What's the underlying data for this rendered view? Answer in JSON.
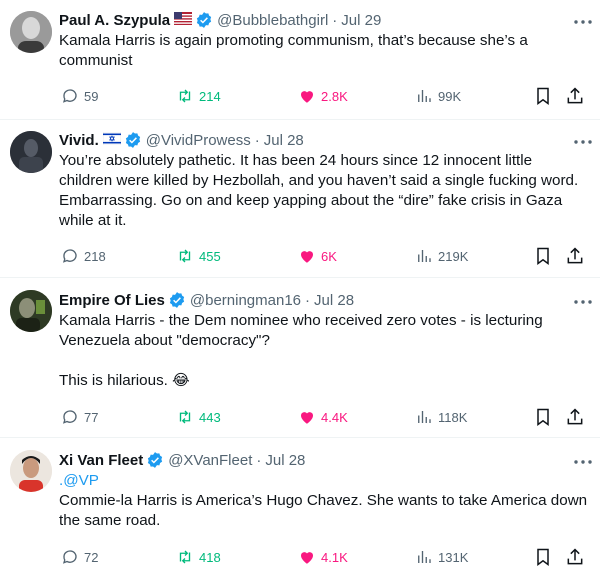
{
  "tweets": [
    {
      "name": "Paul A. Szypula",
      "flag": "us-flag",
      "handle": "@Bubblebathgirl",
      "sep": "·",
      "date": "Jul 29",
      "lines": [
        "Kamala Harris is again promoting communism, that’s because she’s a communist"
      ],
      "replies": "59",
      "retweets": "214",
      "likes": "2.8K",
      "views": "99K"
    },
    {
      "name": "Vivid.",
      "flag": "israel-flag",
      "handle": "@VividProwess",
      "sep": "·",
      "date": "Jul 28",
      "lines": [
        "You’re absolutely pathetic. It has been 24 hours since 12 innocent little children were killed by Hezbollah, and you haven’t said a single fucking word. Embarrassing. Go on and keep yapping about the “dire” fake crisis in Gaza while at it."
      ],
      "replies": "218",
      "retweets": "455",
      "likes": "6K",
      "views": "219K"
    },
    {
      "name": "Empire Of Lies",
      "handle": "@berningman16",
      "sep": "·",
      "date": "Jul 28",
      "lines": [
        "Kamala Harris - the Dem nominee who received zero votes - is lecturing Venezuela about \"democracy\"?",
        "This is hilarious. 😂"
      ],
      "replies": "77",
      "retweets": "443",
      "likes": "4.4K",
      "views": "118K"
    },
    {
      "name": "Xi Van Fleet",
      "handle": "@XVanFleet",
      "sep": "·",
      "date": "Jul 28",
      "mention": ".@VP",
      "lines": [
        "Commie-la Harris is America’s Hugo Chavez. She wants to take America down the same road."
      ],
      "replies": "72",
      "retweets": "418",
      "likes": "4.1K",
      "views": "131K"
    }
  ],
  "icons": {
    "more": "more-icon",
    "reply": "reply-icon",
    "retweet": "retweet-icon",
    "like": "heart-icon",
    "views": "views-icon",
    "bookmark": "bookmark-icon",
    "share": "share-icon"
  },
  "colors": {
    "text": "#0f1419",
    "muted": "#536471",
    "verified": "#1d9bf0",
    "retweet": "#00ba7c",
    "like": "#f91880",
    "divider": "#eff3f4"
  }
}
